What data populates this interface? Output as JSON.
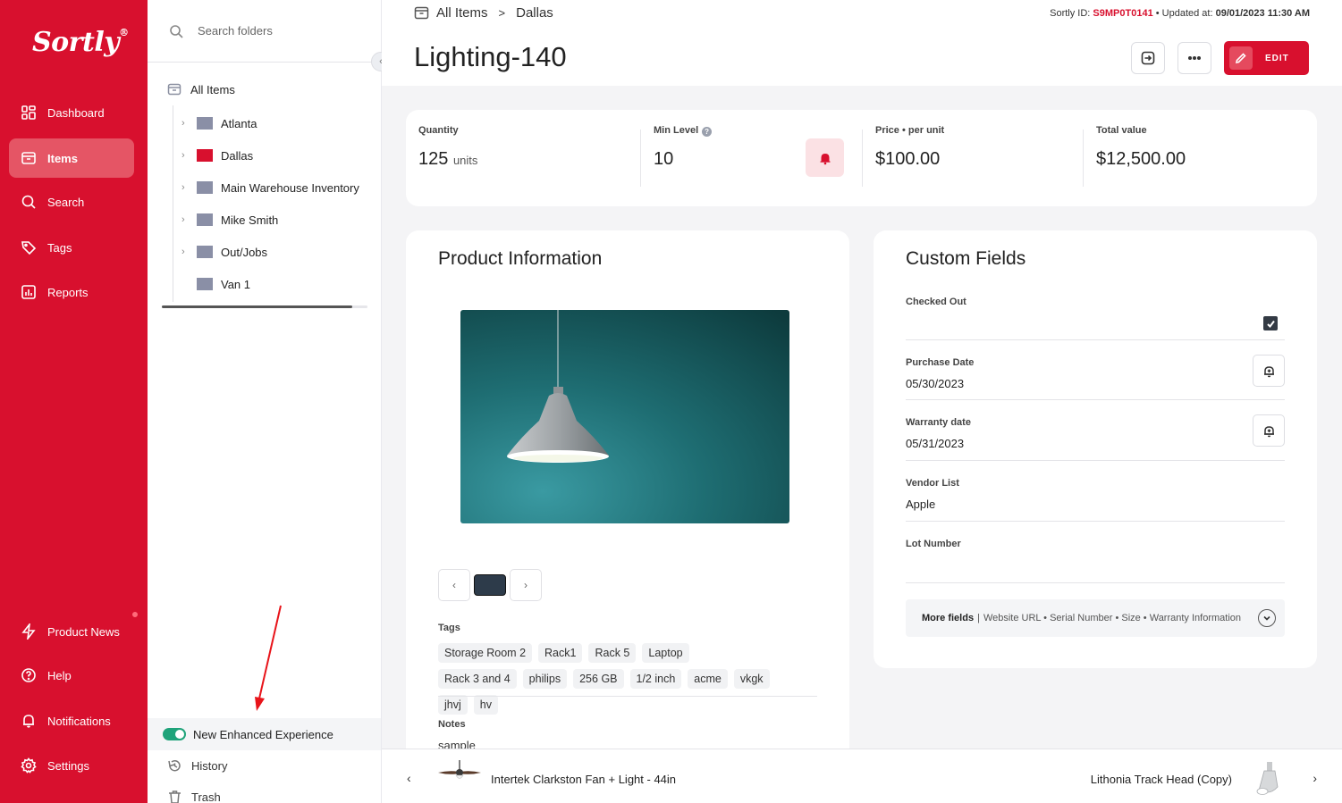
{
  "nav": {
    "logo": "Sortly",
    "logo_mark": "®",
    "items": [
      {
        "label": "Dashboard",
        "icon": "dashboard-icon"
      },
      {
        "label": "Items",
        "icon": "items-icon"
      },
      {
        "label": "Search",
        "icon": "search-icon"
      },
      {
        "label": "Tags",
        "icon": "tags-icon"
      },
      {
        "label": "Reports",
        "icon": "reports-icon"
      },
      {
        "label": "Product News",
        "icon": "bolt-icon"
      },
      {
        "label": "Help",
        "icon": "help-icon"
      },
      {
        "label": "Notifications",
        "icon": "bell-icon"
      },
      {
        "label": "Settings",
        "icon": "gear-icon"
      }
    ],
    "accent": "#d8102e"
  },
  "folders": {
    "search_placeholder": "Search folders",
    "root": "All Items",
    "items": [
      {
        "label": "Atlanta",
        "color": "#8a8fa6",
        "expandable": true
      },
      {
        "label": "Dallas",
        "color": "#d8102e",
        "expandable": true
      },
      {
        "label": "Main Warehouse Inventory",
        "color": "#8a8fa6",
        "expandable": true
      },
      {
        "label": "Mike Smith",
        "color": "#8a8fa6",
        "expandable": true
      },
      {
        "label": "Out/Jobs",
        "color": "#8a8fa6",
        "expandable": true
      },
      {
        "label": "Van 1",
        "color": "#8a8fa6",
        "expandable": false
      }
    ],
    "enhanced_label": "New Enhanced Experience",
    "history_label": "History",
    "trash_label": "Trash"
  },
  "header": {
    "breadcrumb_root": "All Items",
    "breadcrumb_current": "Dallas",
    "sortly_id_label": "Sortly ID:",
    "sortly_id": "S9MP0T0141",
    "updated_label": "Updated at:",
    "updated_value": "09/01/2023 11:30 AM",
    "title": "Lighting-140",
    "edit_label": "EDIT"
  },
  "stats": {
    "quantity_label": "Quantity",
    "quantity_value": "125",
    "quantity_unit": "units",
    "min_label": "Min Level",
    "min_value": "10",
    "price_label": "Price",
    "price_suffix": "per unit",
    "price_value": "$100.00",
    "total_label": "Total value",
    "total_value": "$12,500.00"
  },
  "product": {
    "title": "Product Information",
    "tags_label": "Tags",
    "tags": [
      "Storage Room 2",
      "Rack1",
      "Rack 5",
      "Laptop",
      "Rack 3 and 4",
      "philips",
      "256 GB",
      "1/2 inch",
      "acme",
      "vkgk",
      "jhvj",
      "hv"
    ],
    "notes_label": "Notes",
    "notes_value": "sample"
  },
  "custom": {
    "title": "Custom Fields",
    "checked_out_label": "Checked Out",
    "purchase_label": "Purchase Date",
    "purchase_value": "05/30/2023",
    "warranty_label": "Warranty date",
    "warranty_value": "05/31/2023",
    "vendor_label": "Vendor List",
    "vendor_value": "Apple",
    "lot_label": "Lot Number",
    "more_label": "More fields",
    "more_list": "Website URL • Serial Number • Size • Warranty Information"
  },
  "footer": {
    "prev_item": "Intertek Clarkston Fan + Light - 44in",
    "next_item": "Lithonia Track Head (Copy)"
  }
}
